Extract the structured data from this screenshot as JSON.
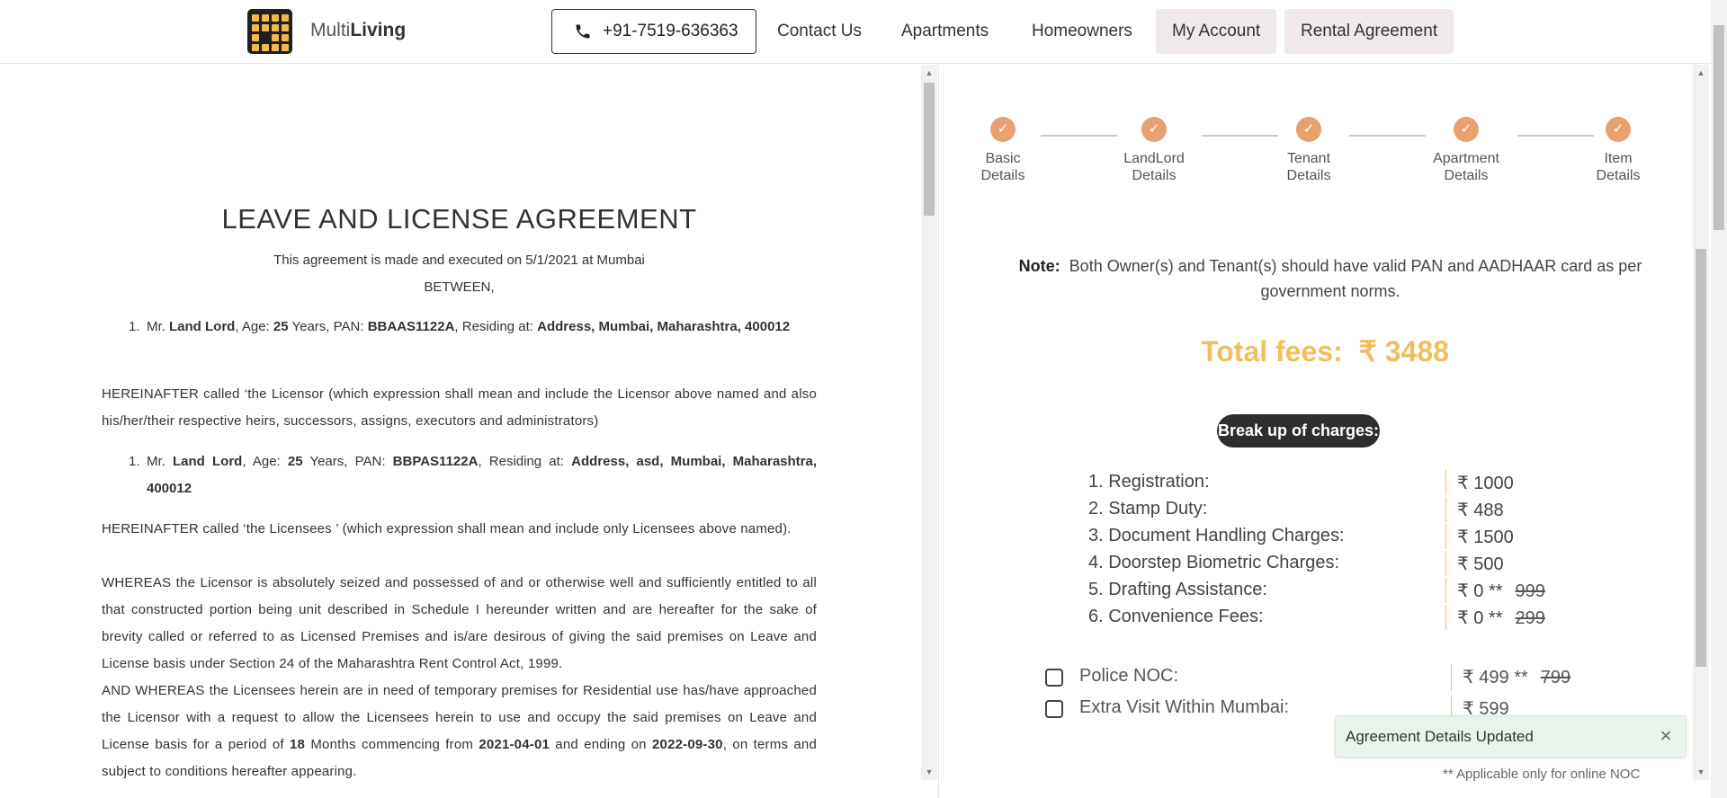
{
  "header": {
    "brand_prefix": "Multi",
    "brand_bold": "Living",
    "phone": "+91-7519-636363",
    "nav": [
      "Contact Us",
      "Apartments",
      "Homeowners",
      "My Account",
      "Rental Agreement"
    ]
  },
  "document": {
    "title": "LEAVE AND LICENSE AGREEMENT",
    "intro": "This agreement is made and executed on 5/1/2021 at Mumbai",
    "between": "BETWEEN,",
    "licensor": {
      "num": "1.",
      "prefix": "Mr.",
      "name": "Land Lord",
      "age_label": ", Age:",
      "age": "25",
      "pan_label": "Years, PAN:",
      "pan": "BBAAS1122A",
      "res_label": ", Residing at:",
      "address": "Address, Mumbai, Maharashtra, 400012"
    },
    "licensor_clause": "HEREINAFTER called ‘the Licensor (which expression shall mean and include the Licensor above named and also his/her/their respective heirs, successors, assigns, executors and administrators)",
    "licensee": {
      "num": "1.",
      "prefix": "Mr.",
      "name": "Land Lord",
      "age_label": ", Age:",
      "age": "25",
      "pan_label": "Years, PAN:",
      "pan": "BBPAS1122A",
      "res_label": ", Residing at:",
      "address": "Address, asd, Mumbai, Maharashtra, 400012"
    },
    "licensee_clause": "HEREINAFTER called ‘the Licensees ’ (which expression shall mean and include only Licensees above named).",
    "whereas_1": "WHEREAS the Licensor is absolutely seized and possessed of and or otherwise well and sufficiently entitled to all that constructed portion being unit described in Schedule I hereunder written and are hereafter for the sake of brevity called or referred to as Licensed Premises and is/are desirous of giving the said premises on Leave and License basis under Section 24 of the Maharashtra Rent Control Act, 1999.",
    "whereas_2_a": "AND WHEREAS the Licensees herein are in need of temporary premises for Residential use has/have approached the Licensor with a request to allow the Licensees herein to use and occupy the said premises on Leave and License basis for a period of",
    "months": "18",
    "whereas_2_b": "Months commencing from",
    "start_date": "2021-04-01",
    "whereas_2_c": "and ending on",
    "end_date": "2022-09-30",
    "whereas_2_d": ", on terms and subject to conditions hereafter appearing."
  },
  "steps": [
    {
      "line1": "Basic",
      "line2": "Details"
    },
    {
      "line1": "LandLord",
      "line2": "Details"
    },
    {
      "line1": "Tenant",
      "line2": "Details"
    },
    {
      "line1": "Apartment",
      "line2": "Details"
    },
    {
      "line1": "Item",
      "line2": "Details"
    }
  ],
  "step_check": "✓",
  "note": {
    "label": "Note:",
    "text": "Both Owner(s) and Tenant(s) should have valid PAN and AADHAAR card as per government norms."
  },
  "total": {
    "label": "Total fees:",
    "value": "₹ 3488"
  },
  "breakup_label": "Break up of charges:",
  "charges": [
    {
      "name": "1. Registration:",
      "value": "₹ 1000",
      "struck": ""
    },
    {
      "name": "2. Stamp Duty:",
      "value": "₹ 488",
      "struck": ""
    },
    {
      "name": "3. Document Handling Charges:",
      "value": "₹ 1500",
      "struck": ""
    },
    {
      "name": "4. Doorstep Biometric Charges:",
      "value": "₹ 500",
      "struck": ""
    },
    {
      "name": "5. Drafting Assistance:",
      "value": "₹ 0 **",
      "struck": "999"
    },
    {
      "name": "6. Convenience Fees:",
      "value": "₹ 0 **",
      "struck": "299"
    }
  ],
  "optional_charges": [
    {
      "name": "Police NOC:",
      "value": "₹ 499  **",
      "struck": "799"
    },
    {
      "name": "Extra Visit Within Mumbai:",
      "value": "₹ 599",
      "struck": ""
    }
  ],
  "footnote": "** Applicable only for online NOC",
  "toast": {
    "message": "Agreement Details Updated",
    "close": "×"
  },
  "colors": {
    "accent": "#f2be5b",
    "step": "#e8a071",
    "pill": "#2e2e2e",
    "toast_bg": "#e7f4ea"
  }
}
